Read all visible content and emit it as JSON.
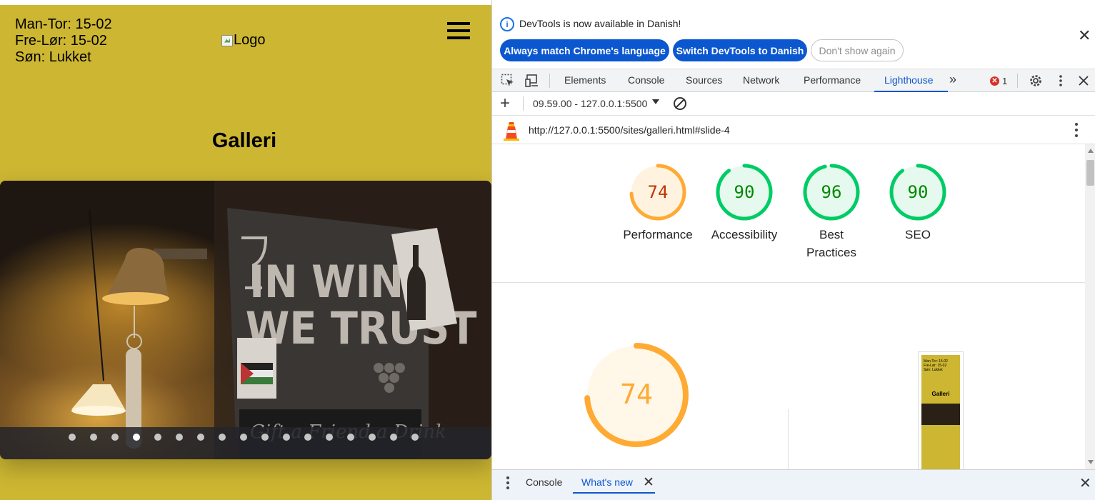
{
  "site": {
    "hours": [
      "Man-Tor: 15-02",
      "Fre-Lør: 15-02",
      "Søn: Lukket"
    ],
    "logo_alt": "Logo",
    "title": "Galleri",
    "slider": {
      "dot_count": 17,
      "active_index": 3
    },
    "colors": {
      "background": "#cdb632"
    }
  },
  "devtools": {
    "infobar": {
      "message": "DevTools is now available in Danish!",
      "buttons": [
        "Always match Chrome's language",
        "Switch DevTools to Danish",
        "Don't show again"
      ]
    },
    "tabs": [
      "Elements",
      "Console",
      "Sources",
      "Network",
      "Performance",
      "Lighthouse"
    ],
    "active_tab": "Lighthouse",
    "more_tabs_icon": "chevron-double-right-icon",
    "error_count": "1",
    "report_selector": "09.59.00 - 127.0.0.1:5500",
    "url": "http://127.0.0.1:5500/sites/galleri.html#slide-4",
    "scores": [
      {
        "value": 74,
        "label": "Performance",
        "color": "#fa3",
        "track": "#fff3e0",
        "text_color": "#c33300"
      },
      {
        "value": 90,
        "label": "Accessibility",
        "color": "#0c6",
        "track": "#e6f9ee",
        "text_color": "#008800"
      },
      {
        "value": 96,
        "label": "Best Practices",
        "color": "#0c6",
        "track": "#e6f9ee",
        "text_color": "#008800"
      },
      {
        "value": 90,
        "label": "SEO",
        "color": "#0c6",
        "track": "#e6f9ee",
        "text_color": "#008800"
      }
    ],
    "main_score": {
      "value": 74,
      "color": "#fa3"
    },
    "thumbnail": {
      "hours": [
        "Man-Tor: 15-02",
        "Fre-Lør: 15-02",
        "Søn: Lukket"
      ],
      "title": "Galleri"
    },
    "drawer": {
      "tabs": [
        "Console",
        "What's new"
      ],
      "active_tab": "What's new"
    }
  }
}
